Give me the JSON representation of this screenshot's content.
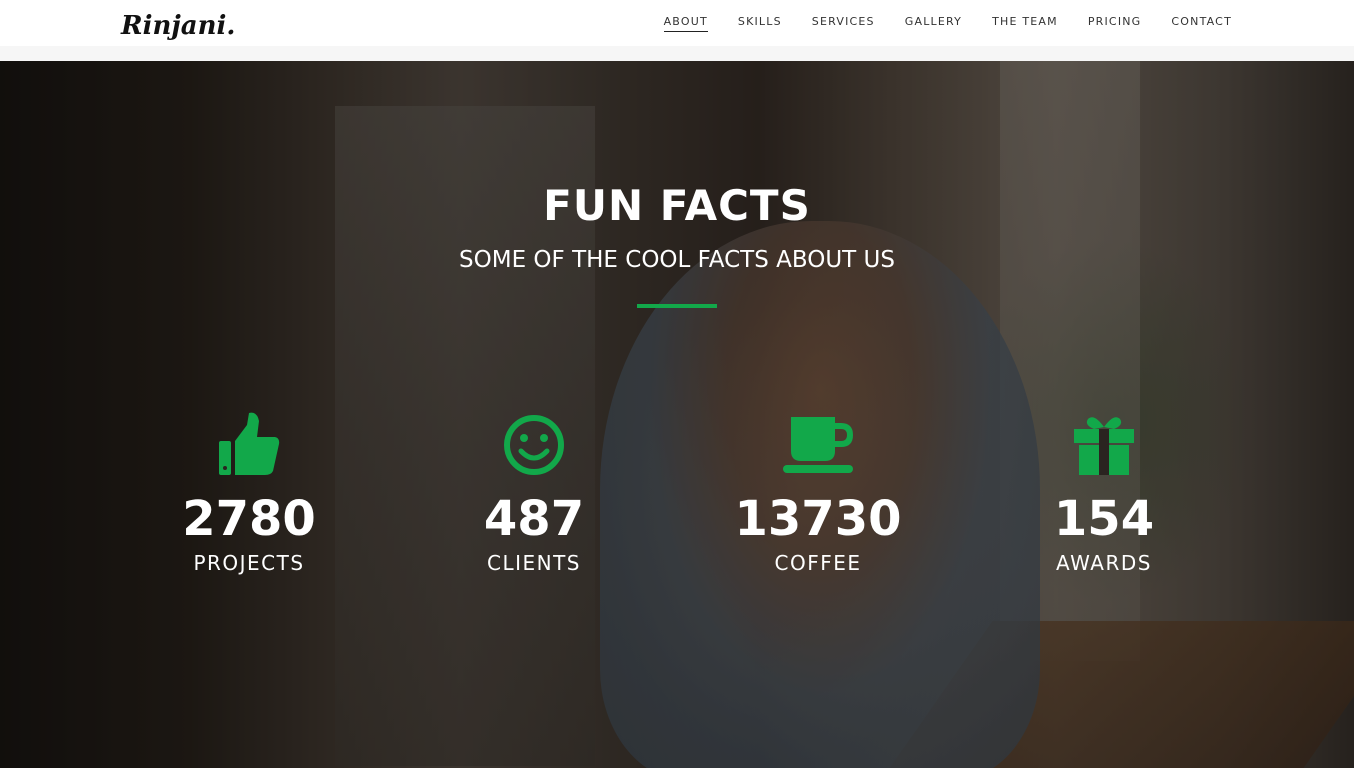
{
  "brand": {
    "logo_text": "Rinjani.",
    "accent_color": "#12a84a"
  },
  "nav": {
    "items": [
      {
        "label": "ABOUT",
        "active": true
      },
      {
        "label": "SKILLS",
        "active": false
      },
      {
        "label": "SERVICES",
        "active": false
      },
      {
        "label": "GALLERY",
        "active": false
      },
      {
        "label": "THE TEAM",
        "active": false
      },
      {
        "label": "PRICING",
        "active": false
      },
      {
        "label": "CONTACT",
        "active": false
      }
    ]
  },
  "hero": {
    "title": "FUN FACTS",
    "subtitle": "SOME OF THE COOL FACTS ABOUT US"
  },
  "stats": [
    {
      "icon": "thumbs-up-icon",
      "number": "2780",
      "label": "PROJECTS"
    },
    {
      "icon": "smiley-icon",
      "number": "487",
      "label": "CLIENTS"
    },
    {
      "icon": "coffee-cup-icon",
      "number": "13730",
      "label": "COFFEE"
    },
    {
      "icon": "gift-icon",
      "number": "154",
      "label": "AWARDS"
    }
  ]
}
